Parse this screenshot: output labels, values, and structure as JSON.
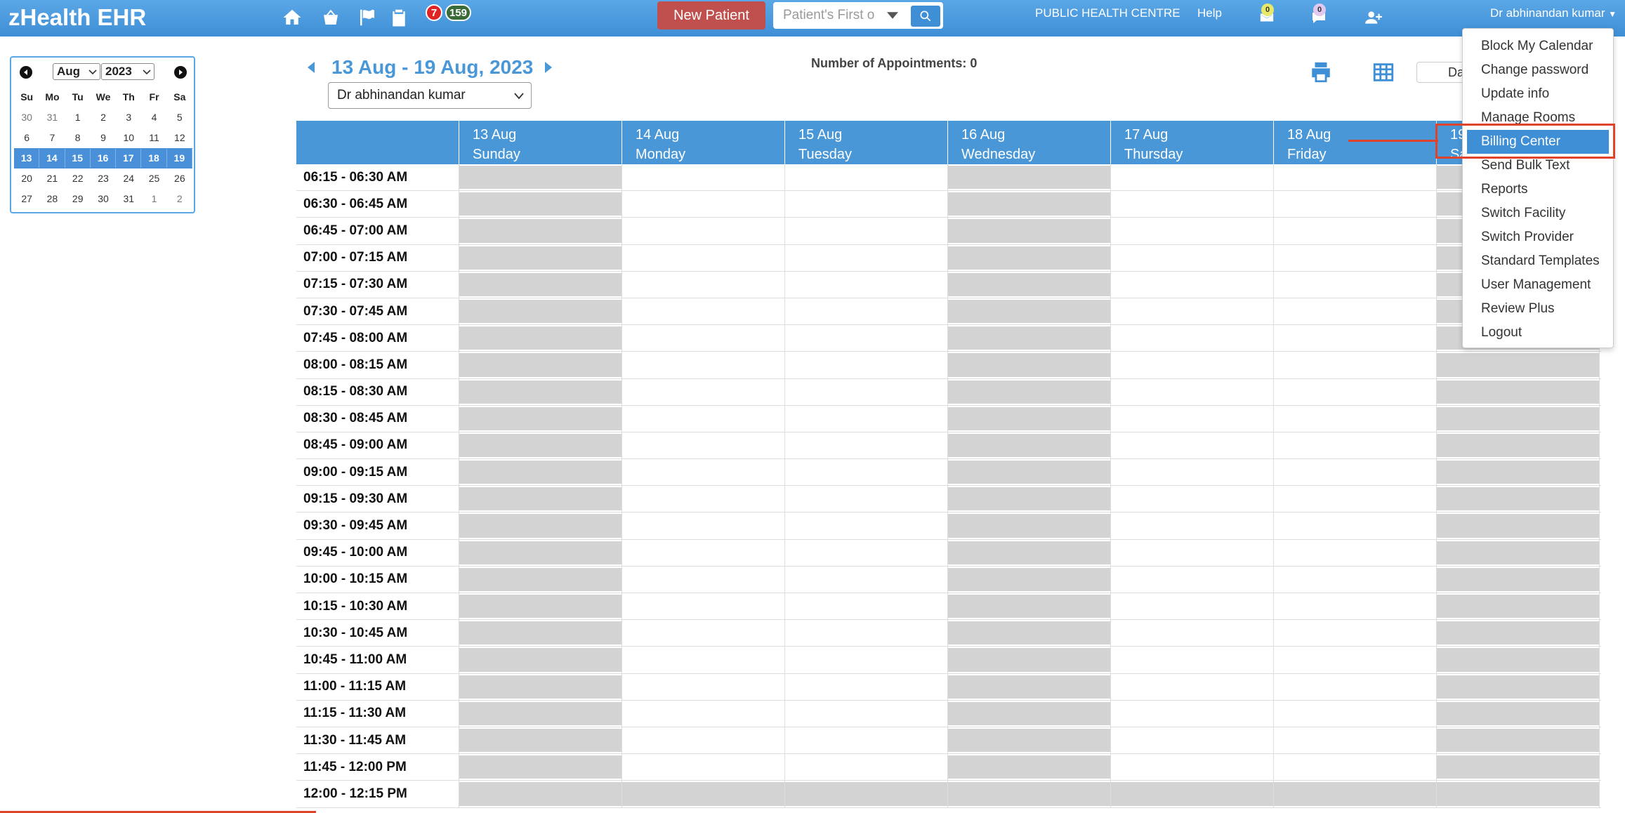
{
  "topbar": {
    "brand": "zHealth EHR",
    "badge_alerts": "7",
    "badge_tasks": "159",
    "new_patient_label": "New Patient",
    "search_placeholder": "Patient's First o",
    "facility": "PUBLIC HEALTH CENTRE",
    "help": "Help",
    "mail_count": "0",
    "chat_count": "0",
    "user": "Dr abhinandan kumar"
  },
  "mini_calendar": {
    "month": "Aug",
    "year": "2023",
    "weekdays": [
      "Su",
      "Mo",
      "Tu",
      "We",
      "Th",
      "Fr",
      "Sa"
    ],
    "weeks": [
      [
        "30",
        "31",
        "1",
        "2",
        "3",
        "4",
        "5"
      ],
      [
        "6",
        "7",
        "8",
        "9",
        "10",
        "11",
        "12"
      ],
      [
        "13",
        "14",
        "15",
        "16",
        "17",
        "18",
        "19"
      ],
      [
        "20",
        "21",
        "22",
        "23",
        "24",
        "25",
        "26"
      ],
      [
        "27",
        "28",
        "29",
        "30",
        "31",
        "1",
        "2"
      ]
    ]
  },
  "schedule": {
    "range_title": "13 Aug - 19 Aug, 2023",
    "provider": "Dr abhinandan kumar",
    "appointment_count": "Number of Appointments: 0",
    "day_button": "Da",
    "days": [
      {
        "date": "13 Aug",
        "weekday": "Sunday"
      },
      {
        "date": "14 Aug",
        "weekday": "Monday"
      },
      {
        "date": "15 Aug",
        "weekday": "Tuesday"
      },
      {
        "date": "16 Aug",
        "weekday": "Wednesday"
      },
      {
        "date": "17 Aug",
        "weekday": "Thursday"
      },
      {
        "date": "18 Aug",
        "weekday": "Friday"
      },
      {
        "date": "19",
        "weekday": "Sa"
      }
    ],
    "times": [
      "06:15 - 06:30 AM",
      "06:30 - 06:45 AM",
      "06:45 - 07:00 AM",
      "07:00 - 07:15 AM",
      "07:15 - 07:30 AM",
      "07:30 - 07:45 AM",
      "07:45 - 08:00 AM",
      "08:00 - 08:15 AM",
      "08:15 - 08:30 AM",
      "08:30 - 08:45 AM",
      "08:45 - 09:00 AM",
      "09:00 - 09:15 AM",
      "09:15 - 09:30 AM",
      "09:30 - 09:45 AM",
      "09:45 - 10:00 AM",
      "10:00 - 10:15 AM",
      "10:15 - 10:30 AM",
      "10:30 - 10:45 AM",
      "10:45 - 11:00 AM",
      "11:00 - 11:15 AM",
      "11:15 - 11:30 AM",
      "11:30 - 11:45 AM",
      "11:45 - 12:00 PM",
      "12:00 - 12:15 PM"
    ]
  },
  "user_menu": {
    "items": [
      "Block My Calendar",
      "Change password",
      "Update info",
      "Manage Rooms",
      "Billing Center",
      "Send Bulk Text",
      "Reports",
      "Switch Facility",
      "Switch Provider",
      "Standard Templates",
      "User Management",
      "Review Plus",
      "Logout"
    ],
    "active_index": 4
  },
  "colors": {
    "topbar": "#4a97d8",
    "new_patient": "#c0504d",
    "blocked_slot": "#d3d3d3",
    "highlight": "#e0432b"
  }
}
